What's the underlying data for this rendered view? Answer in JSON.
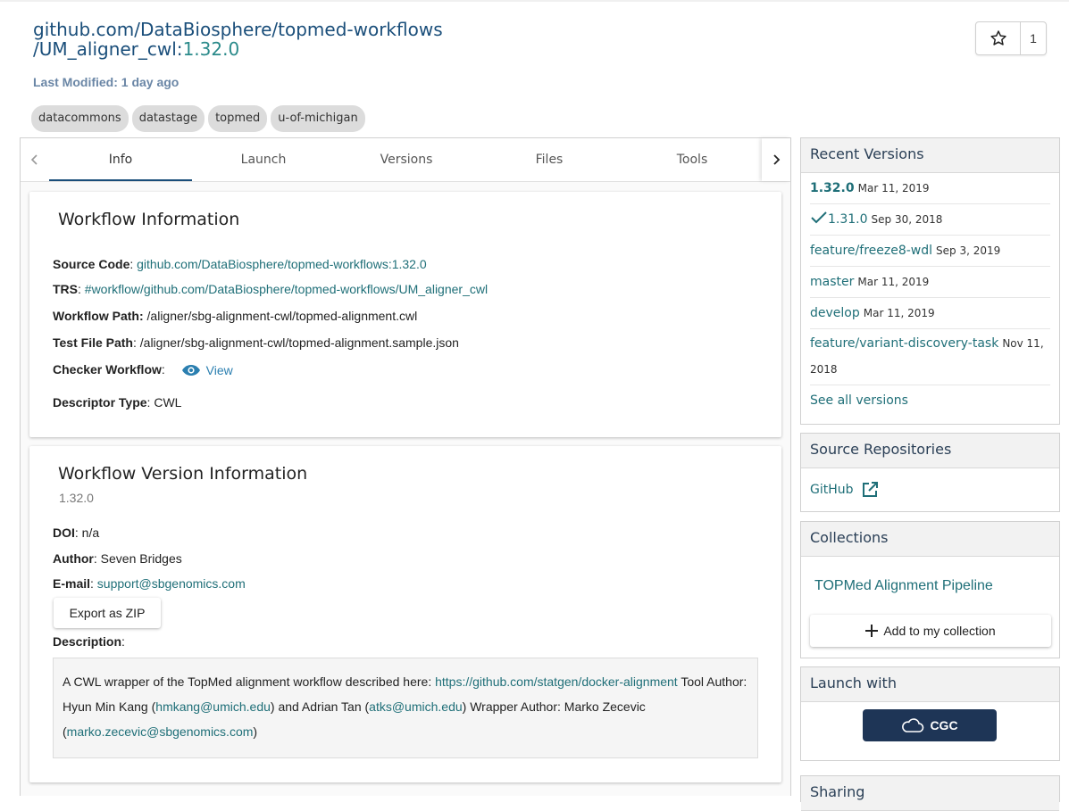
{
  "header": {
    "title_line1": "github.com/DataBiosphere/topmed-workflows",
    "title_line2": "/UM_aligner_cwl:",
    "title_version": "1.32.0",
    "last_modified": "Last Modified: 1 day ago",
    "tags": [
      "datacommons",
      "datastage",
      "topmed",
      "u-of-michigan"
    ],
    "star_count": "1"
  },
  "tabs": [
    "Info",
    "Launch",
    "Versions",
    "Files",
    "Tools"
  ],
  "workflow_info": {
    "heading": "Workflow Information",
    "source_code_label": "Source Code",
    "source_code_value": "github.com/DataBiosphere/topmed-workflows:1.32.0",
    "trs_label": "TRS",
    "trs_value": "#workflow/github.com/DataBiosphere/topmed-workflows/UM_aligner_cwl",
    "workflow_path_label": "Workflow Path:",
    "workflow_path_value": "/aligner/sbg-alignment-cwl/topmed-alignment.cwl",
    "test_file_label": "Test File Path",
    "test_file_value": "/aligner/sbg-alignment-cwl/topmed-alignment.sample.json",
    "checker_label": "Checker Workflow",
    "checker_link": "View",
    "descriptor_label": "Descriptor Type",
    "descriptor_value": "CWL"
  },
  "version_info": {
    "heading": "Workflow Version Information",
    "version": "1.32.0",
    "doi_label": "DOI",
    "doi_value": "n/a",
    "author_label": "Author",
    "author_value": "Seven Bridges",
    "email_label": "E-mail",
    "email_value": "support@sbgenomics.com",
    "export_button": "Export as ZIP",
    "description_label": "Description",
    "desc_part1": "A CWL wrapper of the TopMed alignment workflow described here: ",
    "desc_link1": "https://github.com/statgen/docker-alignment",
    "desc_part2": " Tool Author: Hyun Min Kang (",
    "desc_link2": "hmkang@umich.edu",
    "desc_part3": ") and Adrian Tan (",
    "desc_link3": "atks@umich.edu",
    "desc_part4": ") Wrapper Author: Marko Zecevic (",
    "desc_link4": "marko.zecevic@sbgenomics.com",
    "desc_part5": ")"
  },
  "recent_versions": {
    "heading": "Recent Versions",
    "items": [
      {
        "name": "1.32.0",
        "date": "Mar 11, 2019"
      },
      {
        "name": "1.31.0",
        "date": "Sep 30, 2018"
      },
      {
        "name": "feature/freeze8-wdl",
        "date": "Sep 3, 2019"
      },
      {
        "name": "master",
        "date": "Mar 11, 2019"
      },
      {
        "name": "develop",
        "date": "Mar 11, 2019"
      },
      {
        "name": "feature/variant-discovery-task",
        "date": "Nov 11, 2018"
      }
    ],
    "see_all": "See all versions"
  },
  "source_repos": {
    "heading": "Source Repositories",
    "item": "GitHub"
  },
  "collections": {
    "heading": "Collections",
    "item": "TOPMed Alignment Pipeline",
    "add_button": "Add to my collection"
  },
  "launch_with": {
    "heading": "Launch with",
    "button": "CGC"
  },
  "sharing": {
    "heading": "Sharing"
  },
  "colors": {
    "link": "#1f6f78",
    "title": "#1a4e7a",
    "launch_button": "#1e3556"
  }
}
